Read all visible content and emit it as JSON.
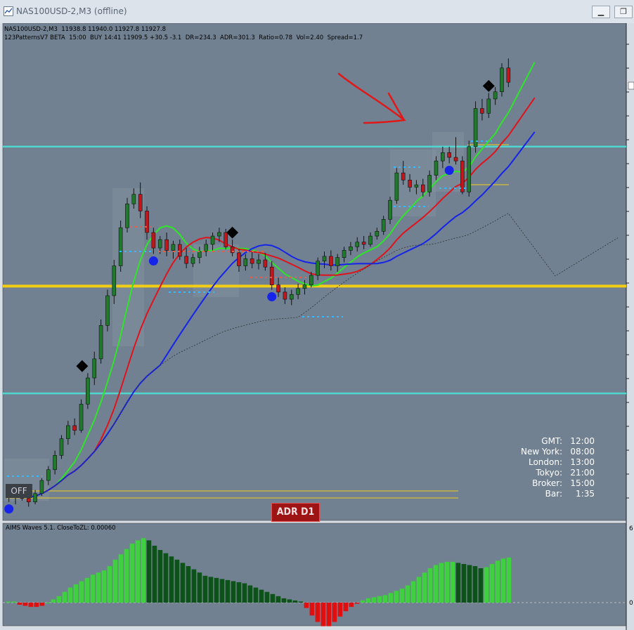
{
  "window": {
    "title": "NAS100USD-2,M3 (offline)",
    "minimize_icon": "minimize-icon",
    "restore_icon": "restore-icon"
  },
  "info_line_1": "NAS100USD-2,M3  11938.8 11940.0 11927.8 11927.8",
  "info_line_2": "123PatternsV7 BETA  15:00  BUY 14:41 11909.5 +30.5 -3.1  DR=234.3  ADR=301.3  Ratio=0.78  Vol=2.40  Spread=1.7",
  "off_button": "OFF",
  "adr_label": "ADR D1",
  "oscillator_label": "AIMS Waves 5.1. CloseToZL: 0.00060",
  "osc_axis": {
    "top": "6",
    "zero": "0"
  },
  "clock": [
    {
      "label": "GMT:",
      "value": "12:00"
    },
    {
      "label": "New York:",
      "value": "08:00"
    },
    {
      "label": "London:",
      "value": "13:00"
    },
    {
      "label": "Tokyo:",
      "value": "21:00"
    },
    {
      "label": "Broker:",
      "value": "15:00"
    },
    {
      "label": "Bar:",
      "value": "1:35"
    }
  ],
  "colors": {
    "plot_bg": "#718191",
    "bull": "#1f7a2c",
    "bear": "#c0171c",
    "ma_green": "#2ee628",
    "ma_red": "#e0121c",
    "ma_blue": "#1524e8",
    "cyan_line": "#4fd6cf",
    "yellow_line": "#f2cd16",
    "osc_green": "#3fd03f",
    "osc_dark": "#0d5218",
    "osc_red": "#e00f10"
  },
  "chart_data": {
    "type": "candlestick",
    "timeframe": "M3",
    "symbol": "NAS100USD-2",
    "candles": [
      [
        11700,
        11705,
        11692,
        11698
      ],
      [
        11698,
        11704,
        11690,
        11700
      ],
      [
        11700,
        11703,
        11693,
        11695
      ],
      [
        11695,
        11699,
        11688,
        11692
      ],
      [
        11692,
        11702,
        11690,
        11699
      ],
      [
        11699,
        11712,
        11697,
        11710
      ],
      [
        11710,
        11722,
        11706,
        11719
      ],
      [
        11719,
        11735,
        11715,
        11731
      ],
      [
        11731,
        11748,
        11728,
        11745
      ],
      [
        11745,
        11760,
        11740,
        11756
      ],
      [
        11756,
        11762,
        11748,
        11752
      ],
      [
        11752,
        11778,
        11750,
        11774
      ],
      [
        11774,
        11800,
        11770,
        11796
      ],
      [
        11796,
        11818,
        11790,
        11812
      ],
      [
        11812,
        11845,
        11808,
        11840
      ],
      [
        11840,
        11870,
        11835,
        11865
      ],
      [
        11865,
        11895,
        11858,
        11890
      ],
      [
        11890,
        11928,
        11885,
        11922
      ],
      [
        11922,
        11947,
        11918,
        11942
      ],
      [
        11942,
        11955,
        11938,
        11950
      ],
      [
        11950,
        11960,
        11930,
        11936
      ],
      [
        11936,
        11940,
        11912,
        11918
      ],
      [
        11918,
        11922,
        11900,
        11905
      ],
      [
        11905,
        11915,
        11900,
        11912
      ],
      [
        11912,
        11918,
        11898,
        11903
      ],
      [
        11903,
        11911,
        11896,
        11908
      ],
      [
        11908,
        11912,
        11895,
        11898
      ],
      [
        11898,
        11905,
        11888,
        11892
      ],
      [
        11892,
        11900,
        11889,
        11897
      ],
      [
        11897,
        11906,
        11892,
        11902
      ],
      [
        11902,
        11912,
        11898,
        11908
      ],
      [
        11908,
        11918,
        11903,
        11915
      ],
      [
        11915,
        11922,
        11910,
        11918
      ],
      [
        11918,
        11921,
        11904,
        11906
      ],
      [
        11906,
        11912,
        11898,
        11901
      ],
      [
        11901,
        11904,
        11885,
        11890
      ],
      [
        11890,
        11900,
        11886,
        11896
      ],
      [
        11896,
        11903,
        11888,
        11892
      ],
      [
        11892,
        11900,
        11887,
        11895
      ],
      [
        11895,
        11901,
        11886,
        11889
      ],
      [
        11889,
        11894,
        11870,
        11874
      ],
      [
        11874,
        11880,
        11864,
        11868
      ],
      [
        11868,
        11872,
        11858,
        11862
      ],
      [
        11862,
        11870,
        11857,
        11866
      ],
      [
        11866,
        11875,
        11862,
        11871
      ],
      [
        11871,
        11878,
        11866,
        11874
      ],
      [
        11874,
        11885,
        11872,
        11882
      ],
      [
        11882,
        11897,
        11878,
        11894
      ],
      [
        11894,
        11902,
        11888,
        11898
      ],
      [
        11898,
        11903,
        11886,
        11890
      ],
      [
        11890,
        11900,
        11885,
        11897
      ],
      [
        11897,
        11906,
        11893,
        11903
      ],
      [
        11903,
        11910,
        11899,
        11906
      ],
      [
        11906,
        11914,
        11902,
        11910
      ],
      [
        11910,
        11915,
        11904,
        11908
      ],
      [
        11908,
        11918,
        11906,
        11915
      ],
      [
        11915,
        11922,
        11912,
        11919
      ],
      [
        11919,
        11932,
        11916,
        11929
      ],
      [
        11929,
        11948,
        11925,
        11945
      ],
      [
        11945,
        11972,
        11942,
        11968
      ],
      [
        11968,
        11978,
        11958,
        11962
      ],
      [
        11962,
        11967,
        11952,
        11956
      ],
      [
        11956,
        11962,
        11950,
        11958
      ],
      [
        11958,
        11963,
        11948,
        11952
      ],
      [
        11952,
        11970,
        11948,
        11966
      ],
      [
        11966,
        11982,
        11962,
        11978
      ],
      [
        11978,
        11990,
        11972,
        11985
      ],
      [
        11985,
        11990,
        11976,
        11981
      ],
      [
        11981,
        11998,
        11975,
        11978
      ],
      [
        11978,
        11982,
        11950,
        11952
      ],
      [
        11952,
        11995,
        11948,
        11990
      ],
      [
        11990,
        12028,
        11985,
        12022
      ],
      [
        12022,
        12030,
        12012,
        12018
      ],
      [
        12018,
        12035,
        12014,
        12030
      ],
      [
        12030,
        12040,
        12025,
        12036
      ],
      [
        12036,
        12060,
        12032,
        12056
      ],
      [
        12056,
        12064,
        12040,
        12044
      ]
    ],
    "horizontal_levels": [
      {
        "name": "cyan-upper",
        "value": 11990
      },
      {
        "name": "yellow-level",
        "value": 11873
      },
      {
        "name": "cyan-lower",
        "value": 11783
      }
    ],
    "ylim": [
      11690,
      12070
    ],
    "oscillator": {
      "type": "histogram",
      "values": [
        0.1,
        0.1,
        -0.2,
        -0.3,
        -0.4,
        -0.4,
        -0.3,
        0,
        0.3,
        0.6,
        1,
        1.4,
        1.7,
        2,
        2.3,
        2.6,
        2.8,
        3,
        3.4,
        4,
        4.5,
        5,
        5.5,
        5.8,
        6,
        5.8,
        5.3,
        4.9,
        4.6,
        4.3,
        4,
        3.7,
        3.4,
        3.1,
        2.8,
        2.5,
        2.4,
        2.3,
        2.2,
        2.1,
        2,
        1.9,
        1.8,
        1.6,
        1.4,
        1.2,
        1,
        0.8,
        0.6,
        0.4,
        0.3,
        0.2,
        0.1,
        -0.5,
        -1.2,
        -1.8,
        -2.2,
        -2.2,
        -1.8,
        -1.3,
        -0.8,
        -0.4,
        -0.1,
        0.2,
        0.4,
        0.5,
        0.6,
        0.7,
        0.9,
        1.1,
        1.3,
        1.6,
        2,
        2.4,
        2.8,
        3.2,
        3.5,
        3.7,
        3.8,
        3.8,
        3.7,
        3.6,
        3.5,
        3.4,
        3.2,
        3.3,
        3.6,
        3.9,
        4.1,
        4.2
      ],
      "ylim": [
        -3,
        7
      ]
    }
  }
}
